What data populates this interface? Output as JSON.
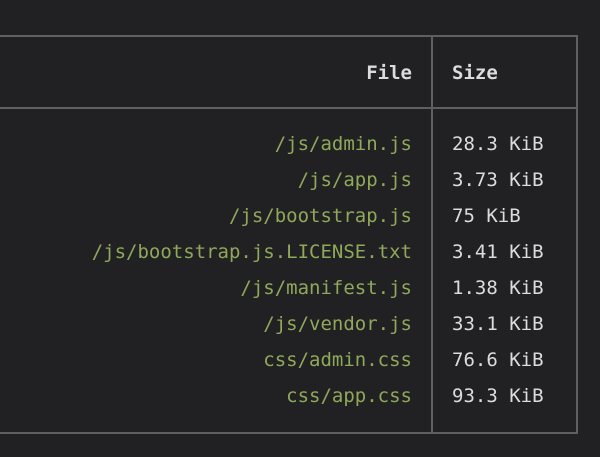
{
  "table": {
    "columns": {
      "file": "File",
      "size": "Size"
    },
    "rows": [
      {
        "file": "/js/admin.js",
        "size": "28.3 KiB"
      },
      {
        "file": "/js/app.js",
        "size": "3.73 KiB"
      },
      {
        "file": "/js/bootstrap.js",
        "size": "75 KiB"
      },
      {
        "file": "/js/bootstrap.js.LICENSE.txt",
        "size": "3.41 KiB"
      },
      {
        "file": "/js/manifest.js",
        "size": "1.38 KiB"
      },
      {
        "file": "/js/vendor.js",
        "size": "33.1 KiB"
      },
      {
        "file": "css/admin.css",
        "size": "76.6 KiB"
      },
      {
        "file": "css/app.css",
        "size": "93.3 KiB"
      }
    ]
  },
  "colors": {
    "background": "#212123",
    "border": "#5f5f62",
    "file_text": "#8fa85a",
    "size_text": "#dcdcdc"
  }
}
